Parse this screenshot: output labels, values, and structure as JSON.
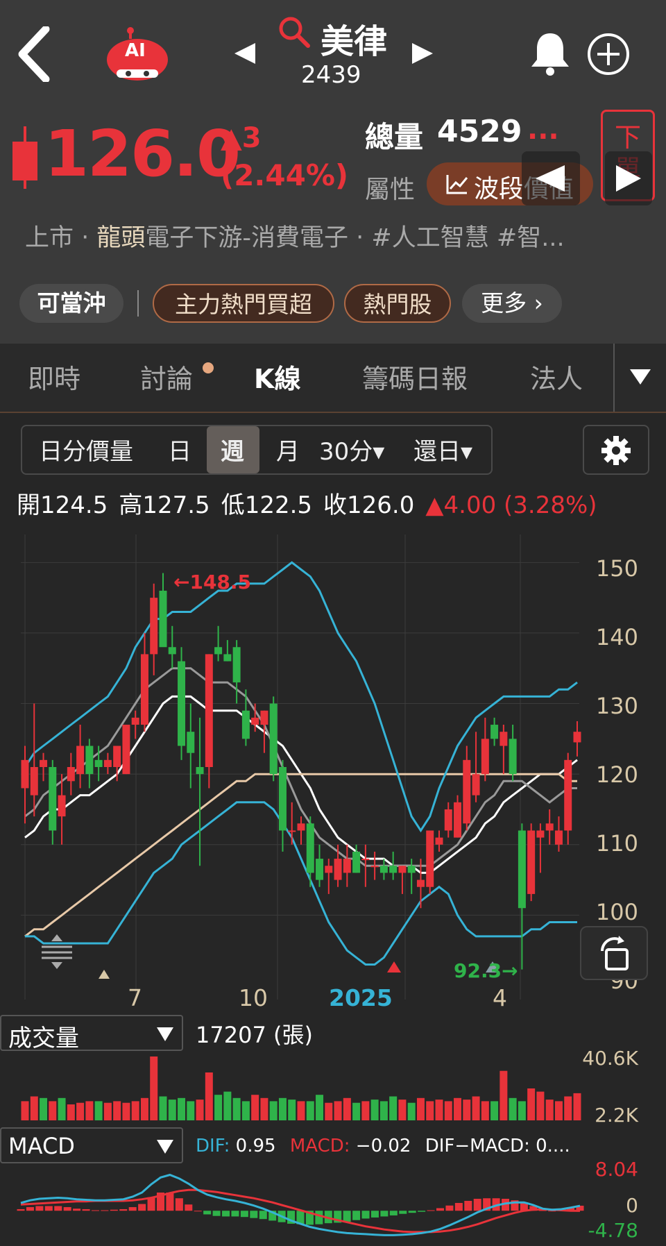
{
  "header": {
    "stock_name": "美律",
    "stock_code": "2439",
    "price": "126.0",
    "change": "▲3",
    "change_pct": "(2.44%)",
    "volume_label": "總量",
    "volume_value": "4529",
    "volume_more": "...",
    "attr_label": "屬性",
    "attr_value": "波段價值",
    "order_btn": "下單",
    "ai_label": "AI",
    "industry_prefix": "上市 ‧ ",
    "industry_highlight": "龍頭",
    "industry_rest": "電子下游-消費電子 ‧ #人工智慧  #智..."
  },
  "tags": [
    "可當沖",
    "主力熱門買超",
    "熱門股",
    "更多 ›"
  ],
  "tabs": [
    "即時",
    "討論",
    "K線",
    "籌碼日報",
    "法人"
  ],
  "active_tab": "K線",
  "period_selector": [
    "日分價量",
    "日",
    "週",
    "月",
    "30分▾",
    "還日▾"
  ],
  "active_period": "週",
  "ohlc": {
    "open_label": "開",
    "open": "124.5",
    "high_label": "高",
    "high": "127.5",
    "low_label": "低",
    "low": "122.5",
    "close_label": "收",
    "close": "126.0",
    "change": "▲4.00 (3.28%)"
  },
  "chart_data": {
    "type": "candlestick",
    "y_ticks": [
      "150",
      "140",
      "130",
      "120",
      "110",
      "100",
      "90"
    ],
    "x_ticks": [
      "7",
      "10",
      "2025",
      "4"
    ],
    "ylim": [
      90,
      152
    ],
    "annotations": {
      "high_marker": "←148.5",
      "low_marker": "92.3→"
    },
    "candles": [
      {
        "o": 118,
        "h": 124,
        "l": 113,
        "c": 122
      },
      {
        "o": 117,
        "h": 130,
        "l": 114,
        "c": 121
      },
      {
        "o": 121,
        "h": 123,
        "l": 119,
        "c": 122
      },
      {
        "o": 121,
        "h": 122,
        "l": 110,
        "c": 112
      },
      {
        "o": 114,
        "h": 120,
        "l": 110,
        "c": 117
      },
      {
        "o": 119,
        "h": 123,
        "l": 117,
        "c": 121
      },
      {
        "o": 120,
        "h": 127,
        "l": 118,
        "c": 124
      },
      {
        "o": 124,
        "h": 125,
        "l": 118,
        "c": 120
      },
      {
        "o": 122,
        "h": 124,
        "l": 119,
        "c": 121
      },
      {
        "o": 121,
        "h": 123,
        "l": 120,
        "c": 122
      },
      {
        "o": 121,
        "h": 124,
        "l": 119,
        "c": 124
      },
      {
        "o": 120,
        "h": 127,
        "l": 120,
        "c": 127
      },
      {
        "o": 127,
        "h": 129,
        "l": 125,
        "c": 128
      },
      {
        "o": 127,
        "h": 140,
        "l": 126,
        "c": 137
      },
      {
        "o": 137,
        "h": 147,
        "l": 134,
        "c": 145
      },
      {
        "o": 146,
        "h": 148.5,
        "l": 139,
        "c": 138
      },
      {
        "o": 138,
        "h": 141,
        "l": 135,
        "c": 137
      },
      {
        "o": 136,
        "h": 138,
        "l": 122,
        "c": 124
      },
      {
        "o": 126,
        "h": 130,
        "l": 118,
        "c": 123
      },
      {
        "o": 121,
        "h": 128,
        "l": 107,
        "c": 120
      },
      {
        "o": 121,
        "h": 137,
        "l": 118,
        "c": 137
      },
      {
        "o": 138,
        "h": 141,
        "l": 136,
        "c": 137
      },
      {
        "o": 137,
        "h": 139,
        "l": 136,
        "c": 136
      },
      {
        "o": 138,
        "h": 139,
        "l": 130,
        "c": 133
      },
      {
        "o": 129,
        "h": 132,
        "l": 124,
        "c": 125
      },
      {
        "o": 127,
        "h": 130,
        "l": 126,
        "c": 128
      },
      {
        "o": 127,
        "h": 129,
        "l": 123,
        "c": 129
      },
      {
        "o": 130,
        "h": 131,
        "l": 119,
        "c": 120
      },
      {
        "o": 121,
        "h": 122,
        "l": 109,
        "c": 112
      },
      {
        "o": 112,
        "h": 116,
        "l": 110,
        "c": 112
      },
      {
        "o": 112,
        "h": 114,
        "l": 110,
        "c": 113
      },
      {
        "o": 113,
        "h": 114,
        "l": 104,
        "c": 106
      },
      {
        "o": 108,
        "h": 110,
        "l": 104,
        "c": 105
      },
      {
        "o": 106,
        "h": 108,
        "l": 103,
        "c": 107
      },
      {
        "o": 105,
        "h": 110,
        "l": 104,
        "c": 108
      },
      {
        "o": 106,
        "h": 110,
        "l": 104,
        "c": 108
      },
      {
        "o": 109,
        "h": 110,
        "l": 106,
        "c": 106
      },
      {
        "o": 108,
        "h": 110,
        "l": 104,
        "c": 108
      },
      {
        "o": 107,
        "h": 109,
        "l": 105,
        "c": 107
      },
      {
        "o": 107,
        "h": 108,
        "l": 105,
        "c": 106
      },
      {
        "o": 107,
        "h": 109,
        "l": 105,
        "c": 106
      },
      {
        "o": 106,
        "h": 107,
        "l": 103,
        "c": 107
      },
      {
        "o": 107,
        "h": 108,
        "l": 103,
        "c": 106
      },
      {
        "o": 104,
        "h": 108,
        "l": 101,
        "c": 105
      },
      {
        "o": 104,
        "h": 112,
        "l": 103,
        "c": 112
      },
      {
        "o": 110,
        "h": 112,
        "l": 109,
        "c": 111
      },
      {
        "o": 112,
        "h": 116,
        "l": 111,
        "c": 115
      },
      {
        "o": 111,
        "h": 117,
        "l": 111,
        "c": 116
      },
      {
        "o": 113,
        "h": 124,
        "l": 112,
        "c": 122
      },
      {
        "o": 117,
        "h": 126,
        "l": 116,
        "c": 120
      },
      {
        "o": 120,
        "h": 128,
        "l": 119,
        "c": 125
      },
      {
        "o": 127,
        "h": 128,
        "l": 124,
        "c": 125
      },
      {
        "o": 124,
        "h": 127,
        "l": 120,
        "c": 126
      },
      {
        "o": 125,
        "h": 127,
        "l": 119,
        "c": 120
      },
      {
        "o": 112,
        "h": 113,
        "l": 92.3,
        "c": 101
      },
      {
        "o": 103,
        "h": 113,
        "l": 102,
        "c": 112
      },
      {
        "o": 111,
        "h": 113,
        "l": 106,
        "c": 112
      },
      {
        "o": 112,
        "h": 115,
        "l": 110,
        "c": 113
      },
      {
        "o": 110,
        "h": 114,
        "l": 109,
        "c": 112
      },
      {
        "o": 112,
        "h": 123,
        "l": 110,
        "c": 122
      },
      {
        "o": 124.5,
        "h": 127.5,
        "l": 122.5,
        "c": 126
      }
    ],
    "series": [
      {
        "name": "MA5",
        "color": "#ffffff",
        "values": [
          111,
          112,
          114,
          115,
          115,
          116,
          117,
          117,
          118,
          119,
          120,
          122,
          124,
          126,
          128,
          130,
          131,
          131,
          131,
          130,
          129,
          129,
          129,
          129,
          128,
          127,
          126,
          125,
          124,
          122,
          120,
          118,
          115,
          113,
          111,
          110,
          109,
          108,
          108,
          108,
          107,
          107,
          107,
          106,
          106,
          107,
          108,
          109,
          110,
          111,
          113,
          114,
          116,
          117,
          118,
          119,
          120,
          120,
          120,
          121,
          122
        ]
      },
      {
        "name": "MA20",
        "color": "#e8c9a8",
        "values": [
          97,
          98,
          98,
          99,
          100,
          101,
          102,
          103,
          104,
          105,
          106,
          107,
          108,
          109,
          110,
          111,
          112,
          113,
          114,
          115,
          116,
          117,
          118,
          119,
          119,
          120,
          120,
          120,
          120,
          120,
          120,
          120,
          120,
          120,
          120,
          120,
          120,
          120,
          120,
          120,
          120,
          120,
          120,
          120,
          120,
          120,
          120,
          120,
          120,
          120,
          120,
          120,
          120,
          120,
          120,
          120,
          120,
          120,
          120,
          119,
          119
        ]
      },
      {
        "name": "MA10",
        "color": "#9a9a9a",
        "values": [
          114,
          115,
          117,
          118,
          119,
          120,
          121,
          122,
          123,
          124,
          126,
          128,
          130,
          132,
          133,
          134,
          135,
          135,
          135,
          134,
          133,
          133,
          133,
          132,
          131,
          129,
          127,
          124,
          121,
          118,
          115,
          113,
          111,
          110,
          109,
          108,
          108,
          107,
          107,
          107,
          107,
          107,
          107,
          107,
          107,
          108,
          109,
          110,
          112,
          114,
          116,
          117,
          119,
          119,
          119,
          118,
          117,
          116,
          117,
          118,
          118
        ]
      },
      {
        "name": "BB-Upper",
        "color": "#36b3d6",
        "values": [
          121,
          123,
          124,
          125,
          126,
          127,
          128,
          129,
          130,
          131,
          133,
          135,
          138,
          140,
          142,
          142,
          143,
          143,
          143,
          144,
          145,
          146,
          146,
          147,
          147,
          147,
          147,
          148,
          149,
          150,
          149,
          148,
          146,
          143,
          140,
          138,
          136,
          133,
          130,
          126,
          122,
          118,
          114,
          112,
          114,
          118,
          121,
          124,
          126,
          128,
          129,
          130,
          131,
          131,
          131,
          131,
          131,
          131,
          132,
          132,
          133
        ]
      },
      {
        "name": "BB-Lower",
        "color": "#36b3d6",
        "values": [
          97,
          97,
          96,
          96,
          96,
          96,
          96,
          96,
          96,
          96,
          98,
          100,
          102,
          104,
          106,
          107,
          108,
          110,
          111,
          112,
          113,
          114,
          115,
          116,
          116,
          116,
          116,
          115,
          113,
          111,
          108,
          105,
          102,
          99,
          97,
          95,
          94,
          93,
          93,
          94,
          96,
          98,
          100,
          102,
          103,
          104,
          103,
          100,
          98,
          97,
          97,
          97,
          97,
          97,
          97,
          98,
          98,
          99,
          99,
          99,
          99
        ]
      }
    ]
  },
  "volume_panel": {
    "label": "成交量",
    "value": "17207 (張)",
    "max_tick": "40.6K",
    "min_tick": "2.2K",
    "values": [
      12,
      15,
      14,
      12,
      14,
      10,
      11,
      12,
      12,
      11,
      12,
      11,
      12,
      14,
      40,
      15,
      13,
      14,
      12,
      13,
      30,
      16,
      18,
      14,
      12,
      16,
      14,
      12,
      14,
      13,
      12,
      12,
      16,
      11,
      12,
      14,
      11,
      12,
      13,
      12,
      15,
      13,
      11,
      14,
      12,
      13,
      12,
      14,
      13,
      15,
      12,
      12,
      31,
      14,
      12,
      20,
      18,
      13,
      12,
      15,
      17
    ],
    "up": [
      1,
      1,
      0,
      1,
      0,
      1,
      1,
      1,
      0,
      1,
      1,
      1,
      1,
      1,
      1,
      0,
      0,
      0,
      0,
      1,
      1,
      0,
      0,
      0,
      0,
      1,
      1,
      0,
      0,
      0,
      1,
      0,
      0,
      1,
      1,
      1,
      0,
      1,
      0,
      0,
      0,
      1,
      0,
      1,
      1,
      1,
      1,
      1,
      1,
      1,
      1,
      0,
      1,
      0,
      0,
      1,
      1,
      1,
      1,
      1,
      1
    ]
  },
  "macd_panel": {
    "label": "MACD",
    "dif_label": "DIF:",
    "dif_value": "0.95",
    "macd_label": "MACD:",
    "macd_value": "−0.02",
    "diff_label": "DIF−MACD: 0....",
    "max_tick": "8.04",
    "zero_tick": "0",
    "min_tick": "-4.78",
    "dif": [
      1.5,
      2.0,
      2.3,
      2.4,
      2.5,
      2.4,
      2.2,
      2.1,
      2.0,
      2.0,
      2.1,
      2.2,
      2.7,
      3.5,
      5.1,
      6.4,
      6.9,
      6.2,
      5.2,
      4.0,
      3.1,
      2.6,
      2.2,
      1.9,
      1.5,
      1.0,
      0.4,
      -0.3,
      -1.1,
      -1.9,
      -2.5,
      -3.1,
      -3.5,
      -3.8,
      -4.1,
      -4.3,
      -4.4,
      -4.5,
      -4.6,
      -4.7,
      -4.7,
      -4.6,
      -4.5,
      -4.3,
      -4.0,
      -3.5,
      -2.8,
      -2.0,
      -1.2,
      -0.3,
      0.4,
      1.0,
      1.4,
      1.6,
      1.6,
      1.1,
      0.4,
      0.2,
      0.3,
      0.6,
      0.95
    ],
    "macd": [
      1.2,
      1.3,
      1.4,
      1.5,
      1.6,
      1.7,
      1.8,
      1.8,
      1.9,
      1.9,
      1.9,
      1.9,
      2.0,
      2.2,
      2.5,
      2.9,
      3.4,
      3.8,
      4.0,
      4.0,
      3.8,
      3.6,
      3.3,
      3.0,
      2.7,
      2.4,
      2.0,
      1.6,
      1.1,
      0.6,
      0.1,
      -0.4,
      -0.9,
      -1.4,
      -1.8,
      -2.2,
      -2.6,
      -3.0,
      -3.3,
      -3.6,
      -3.8,
      -4.0,
      -4.1,
      -4.1,
      -4.1,
      -4.0,
      -3.8,
      -3.5,
      -3.1,
      -2.6,
      -2.0,
      -1.4,
      -0.9,
      -0.4,
      0.0,
      0.2,
      0.3,
      0.2,
      0.1,
      0.0,
      -0.02
    ]
  }
}
